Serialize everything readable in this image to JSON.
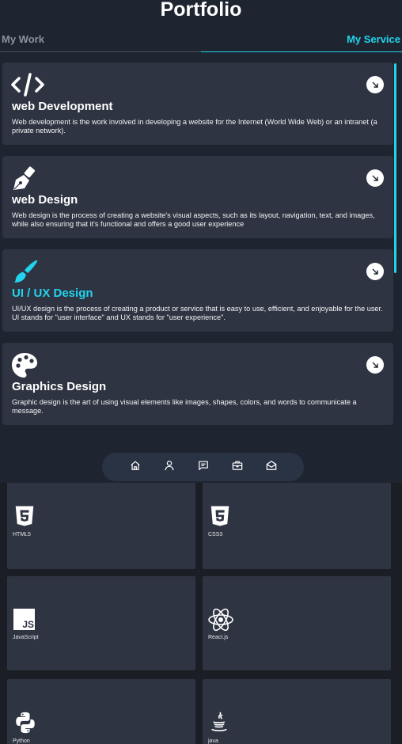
{
  "header": {
    "title": "Portfolio"
  },
  "tabs": [
    {
      "label": "My Work",
      "active": false
    },
    {
      "label": "My Service",
      "active": true
    }
  ],
  "services": [
    {
      "icon": "code-icon",
      "title": "web Development",
      "description": "Web development is the work involved in developing a website for the Internet (World Wide Web) or an intranet (a private network)."
    },
    {
      "icon": "pen-nib-icon",
      "title": "web Design",
      "description": "Web design is the process of creating a website's visual aspects, such as its layout, navigation, text, and images, while also ensuring that it's functional and offers a good user experience"
    },
    {
      "icon": "paintbrush-icon",
      "title": "UI / UX Design",
      "description": "UI/UX design is the process of creating a product or service that is easy to use, efficient, and enjoyable for the user. UI stands for \"user interface\" and UX stands for \"user experience\"."
    },
    {
      "icon": "palette-icon",
      "title": "Graphics Design",
      "description": "Graphic design is the art of using visual elements like images, shapes, colors, and words to communicate a message."
    }
  ],
  "nav": [
    {
      "icon": "home-icon"
    },
    {
      "icon": "user-icon"
    },
    {
      "icon": "chat-icon"
    },
    {
      "icon": "briefcase-icon"
    },
    {
      "icon": "mail-icon"
    }
  ],
  "skills": [
    {
      "label": "HTML5",
      "icon": "html5-icon"
    },
    {
      "label": "CSS3",
      "icon": "css3-icon"
    },
    {
      "label": "JavaScript",
      "icon": "javascript-icon"
    },
    {
      "label": "React.js",
      "icon": "react-icon"
    },
    {
      "label": "Python",
      "icon": "python-icon"
    },
    {
      "label": "java",
      "icon": "java-icon"
    }
  ],
  "colors": {
    "accent": "#22d3ee",
    "panel": "#1f2530",
    "card": "#2e3441",
    "page": "#1b1e25"
  }
}
